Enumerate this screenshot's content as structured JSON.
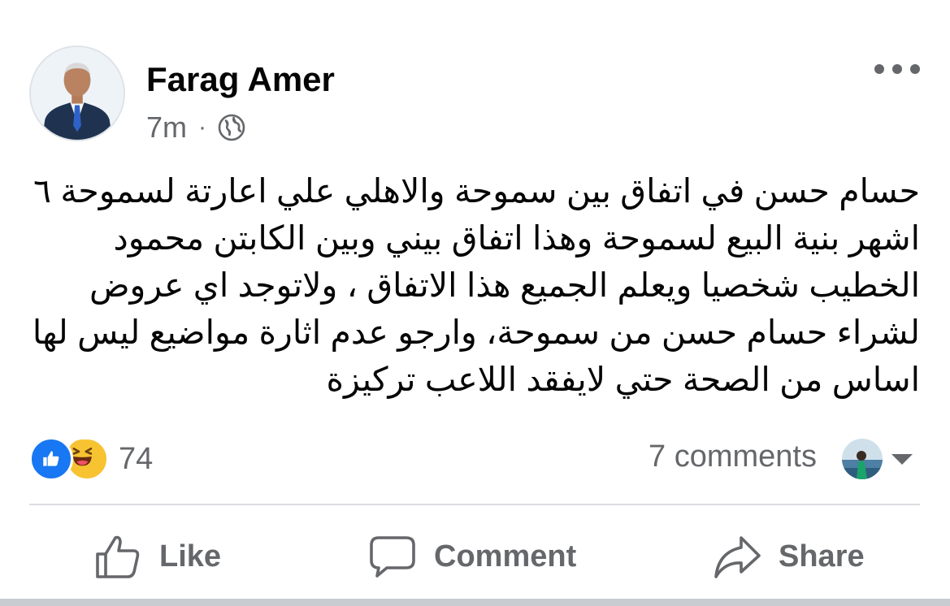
{
  "post": {
    "author": "Farag Amer",
    "timestamp": "7m",
    "separator": "·",
    "audience_icon": "globe-icon",
    "more_icon": "more-options-icon",
    "text": "حسام حسن في اتفاق بين سموحة والاهلي علي اعارتة لسموحة ٦ اشهر بنية البيع لسموحة  وهذا اتفاق بيني وبين الكابتن محمود الخطيب شخصيا ويعلم الجميع هذا الاتفاق ، ولاتوجد اي عروض لشراء حسام حسن من سموحة، وارجو عدم اثارة مواضيع ليس لها اساس من الصحة حتي لايفقد اللاعب تركيزة"
  },
  "stats": {
    "reaction_icons": [
      "like-reaction-icon",
      "haha-reaction-icon"
    ],
    "reaction_count": "74",
    "comments": "7 comments"
  },
  "actions": {
    "like": "Like",
    "comment": "Comment",
    "share": "Share"
  },
  "colors": {
    "text": "#050505",
    "secondary": "#65676b",
    "like_blue": "#1877f2",
    "haha_yellow": "#f7c331",
    "divider": "#dadde1"
  }
}
